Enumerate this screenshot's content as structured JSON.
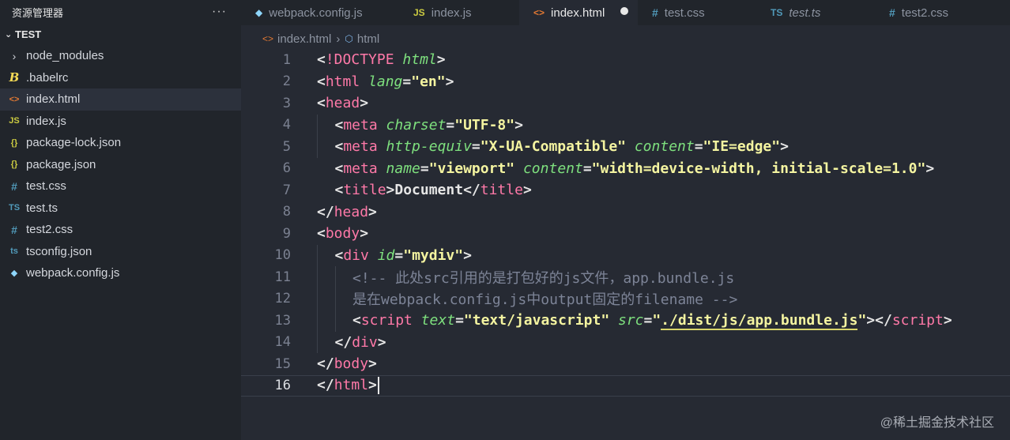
{
  "sidebar": {
    "title": "资源管理器",
    "more": "···",
    "project": "TEST",
    "files": [
      {
        "icon": "›",
        "type": "chev",
        "label": "node_modules"
      },
      {
        "icon": "B",
        "type": "babel",
        "label": ".babelrc"
      },
      {
        "icon": "<>",
        "type": "html",
        "label": "index.html",
        "active": true
      },
      {
        "icon": "JS",
        "type": "js",
        "label": "index.js"
      },
      {
        "icon": "{}",
        "type": "json",
        "label": "package-lock.json"
      },
      {
        "icon": "{}",
        "type": "json",
        "label": "package.json"
      },
      {
        "icon": "#",
        "type": "css",
        "label": "test.css"
      },
      {
        "icon": "TS",
        "type": "ts",
        "label": "test.ts"
      },
      {
        "icon": "#",
        "type": "css",
        "label": "test2.css"
      },
      {
        "icon": "ts",
        "type": "tsconfig",
        "label": "tsconfig.json"
      },
      {
        "icon": "◆",
        "type": "webpack",
        "label": "webpack.config.js"
      }
    ]
  },
  "tabs": [
    {
      "icon": "◆",
      "type": "webpack",
      "label": "webpack.config.js",
      "width": 200
    },
    {
      "icon": "JS",
      "type": "js",
      "label": "index.js",
      "width": 152
    },
    {
      "icon": "<>",
      "type": "html",
      "label": "index.html",
      "width": 150,
      "active": true
    },
    {
      "icon": "#",
      "type": "css",
      "label": "test.css",
      "width": 150
    },
    {
      "icon": "TS",
      "type": "ts",
      "label": "test.ts",
      "width": 150,
      "italic": true
    },
    {
      "icon": "#",
      "type": "css",
      "label": "test2.css",
      "width": 171
    }
  ],
  "breadcrumb": {
    "file": "index.html",
    "symbol": "html"
  },
  "editor": {
    "lines": [
      {
        "n": "1",
        "indent": 0,
        "parts": [
          [
            "b",
            "<"
          ],
          [
            "t",
            "!DOCTYPE"
          ],
          [
            "b",
            " "
          ],
          [
            "a",
            "html"
          ],
          [
            "b",
            ">"
          ]
        ]
      },
      {
        "n": "2",
        "indent": 0,
        "parts": [
          [
            "b",
            "<"
          ],
          [
            "t",
            "html"
          ],
          [
            "b",
            " "
          ],
          [
            "a",
            "lang"
          ],
          [
            "b",
            "="
          ],
          [
            "s",
            "\"en\""
          ],
          [
            "b",
            ">"
          ]
        ]
      },
      {
        "n": "3",
        "indent": 0,
        "parts": [
          [
            "b",
            "<"
          ],
          [
            "t",
            "head"
          ],
          [
            "b",
            ">"
          ]
        ]
      },
      {
        "n": "4",
        "indent": 1,
        "parts": [
          [
            "b",
            "<"
          ],
          [
            "t",
            "meta"
          ],
          [
            "b",
            " "
          ],
          [
            "a",
            "charset"
          ],
          [
            "b",
            "="
          ],
          [
            "s",
            "\"UTF-8\""
          ],
          [
            "b",
            ">"
          ]
        ]
      },
      {
        "n": "5",
        "indent": 1,
        "parts": [
          [
            "b",
            "<"
          ],
          [
            "t",
            "meta"
          ],
          [
            "b",
            " "
          ],
          [
            "a",
            "http-equiv"
          ],
          [
            "b",
            "="
          ],
          [
            "s",
            "\"X-UA-Compatible\""
          ],
          [
            "b",
            " "
          ],
          [
            "a",
            "content"
          ],
          [
            "b",
            "="
          ],
          [
            "s",
            "\"IE=edge\""
          ],
          [
            "b",
            ">"
          ]
        ]
      },
      {
        "n": "6",
        "indent": 1,
        "parts": [
          [
            "b",
            "<"
          ],
          [
            "t",
            "meta"
          ],
          [
            "b",
            " "
          ],
          [
            "a",
            "name"
          ],
          [
            "b",
            "="
          ],
          [
            "s",
            "\"viewport\""
          ],
          [
            "b",
            " "
          ],
          [
            "a",
            "content"
          ],
          [
            "b",
            "="
          ],
          [
            "s",
            "\"width=device-width, initial-scale=1.0\""
          ],
          [
            "b",
            ">"
          ]
        ]
      },
      {
        "n": "7",
        "indent": 1,
        "parts": [
          [
            "b",
            "<"
          ],
          [
            "t",
            "title"
          ],
          [
            "b",
            ">Document</"
          ],
          [
            "t",
            "title"
          ],
          [
            "b",
            ">"
          ]
        ]
      },
      {
        "n": "8",
        "indent": 0,
        "parts": [
          [
            "b",
            "</"
          ],
          [
            "t",
            "head"
          ],
          [
            "b",
            ">"
          ]
        ]
      },
      {
        "n": "9",
        "indent": 0,
        "parts": [
          [
            "b",
            "<"
          ],
          [
            "t",
            "body"
          ],
          [
            "b",
            ">"
          ]
        ]
      },
      {
        "n": "10",
        "indent": 1,
        "parts": [
          [
            "b",
            "<"
          ],
          [
            "t",
            "div"
          ],
          [
            "b",
            " "
          ],
          [
            "a",
            "id"
          ],
          [
            "b",
            "="
          ],
          [
            "s",
            "\"mydiv\""
          ],
          [
            "b",
            ">"
          ]
        ]
      },
      {
        "n": "11",
        "indent": 2,
        "parts": [
          [
            "c",
            "<!-- 此处src引用的是打包好的js文件，app.bundle.js"
          ]
        ]
      },
      {
        "n": "12",
        "indent": 2,
        "parts": [
          [
            "c",
            "是在webpack.config.js中output固定的filename -->"
          ]
        ]
      },
      {
        "n": "13",
        "indent": 2,
        "parts": [
          [
            "b",
            "<"
          ],
          [
            "t",
            "script"
          ],
          [
            "b",
            " "
          ],
          [
            "a",
            "text"
          ],
          [
            "b",
            "="
          ],
          [
            "s",
            "\"text/javascript\""
          ],
          [
            "b",
            " "
          ],
          [
            "a",
            "src"
          ],
          [
            "b",
            "="
          ],
          [
            "s",
            "\""
          ],
          [
            "su",
            "./dist/js/app.bundle.js"
          ],
          [
            "s",
            "\""
          ],
          [
            "b",
            "></"
          ],
          [
            "t",
            "script"
          ],
          [
            "b",
            ">"
          ]
        ]
      },
      {
        "n": "14",
        "indent": 1,
        "parts": [
          [
            "b",
            "</"
          ],
          [
            "t",
            "div"
          ],
          [
            "b",
            ">"
          ]
        ]
      },
      {
        "n": "15",
        "indent": 0,
        "parts": [
          [
            "b",
            "</"
          ],
          [
            "t",
            "body"
          ],
          [
            "b",
            ">"
          ]
        ]
      },
      {
        "n": "16",
        "indent": 0,
        "current": true,
        "parts": [
          [
            "b",
            "</"
          ],
          [
            "t",
            "html"
          ],
          [
            "b",
            ">"
          ]
        ]
      }
    ]
  },
  "watermark": "@稀土掘金技术社区"
}
